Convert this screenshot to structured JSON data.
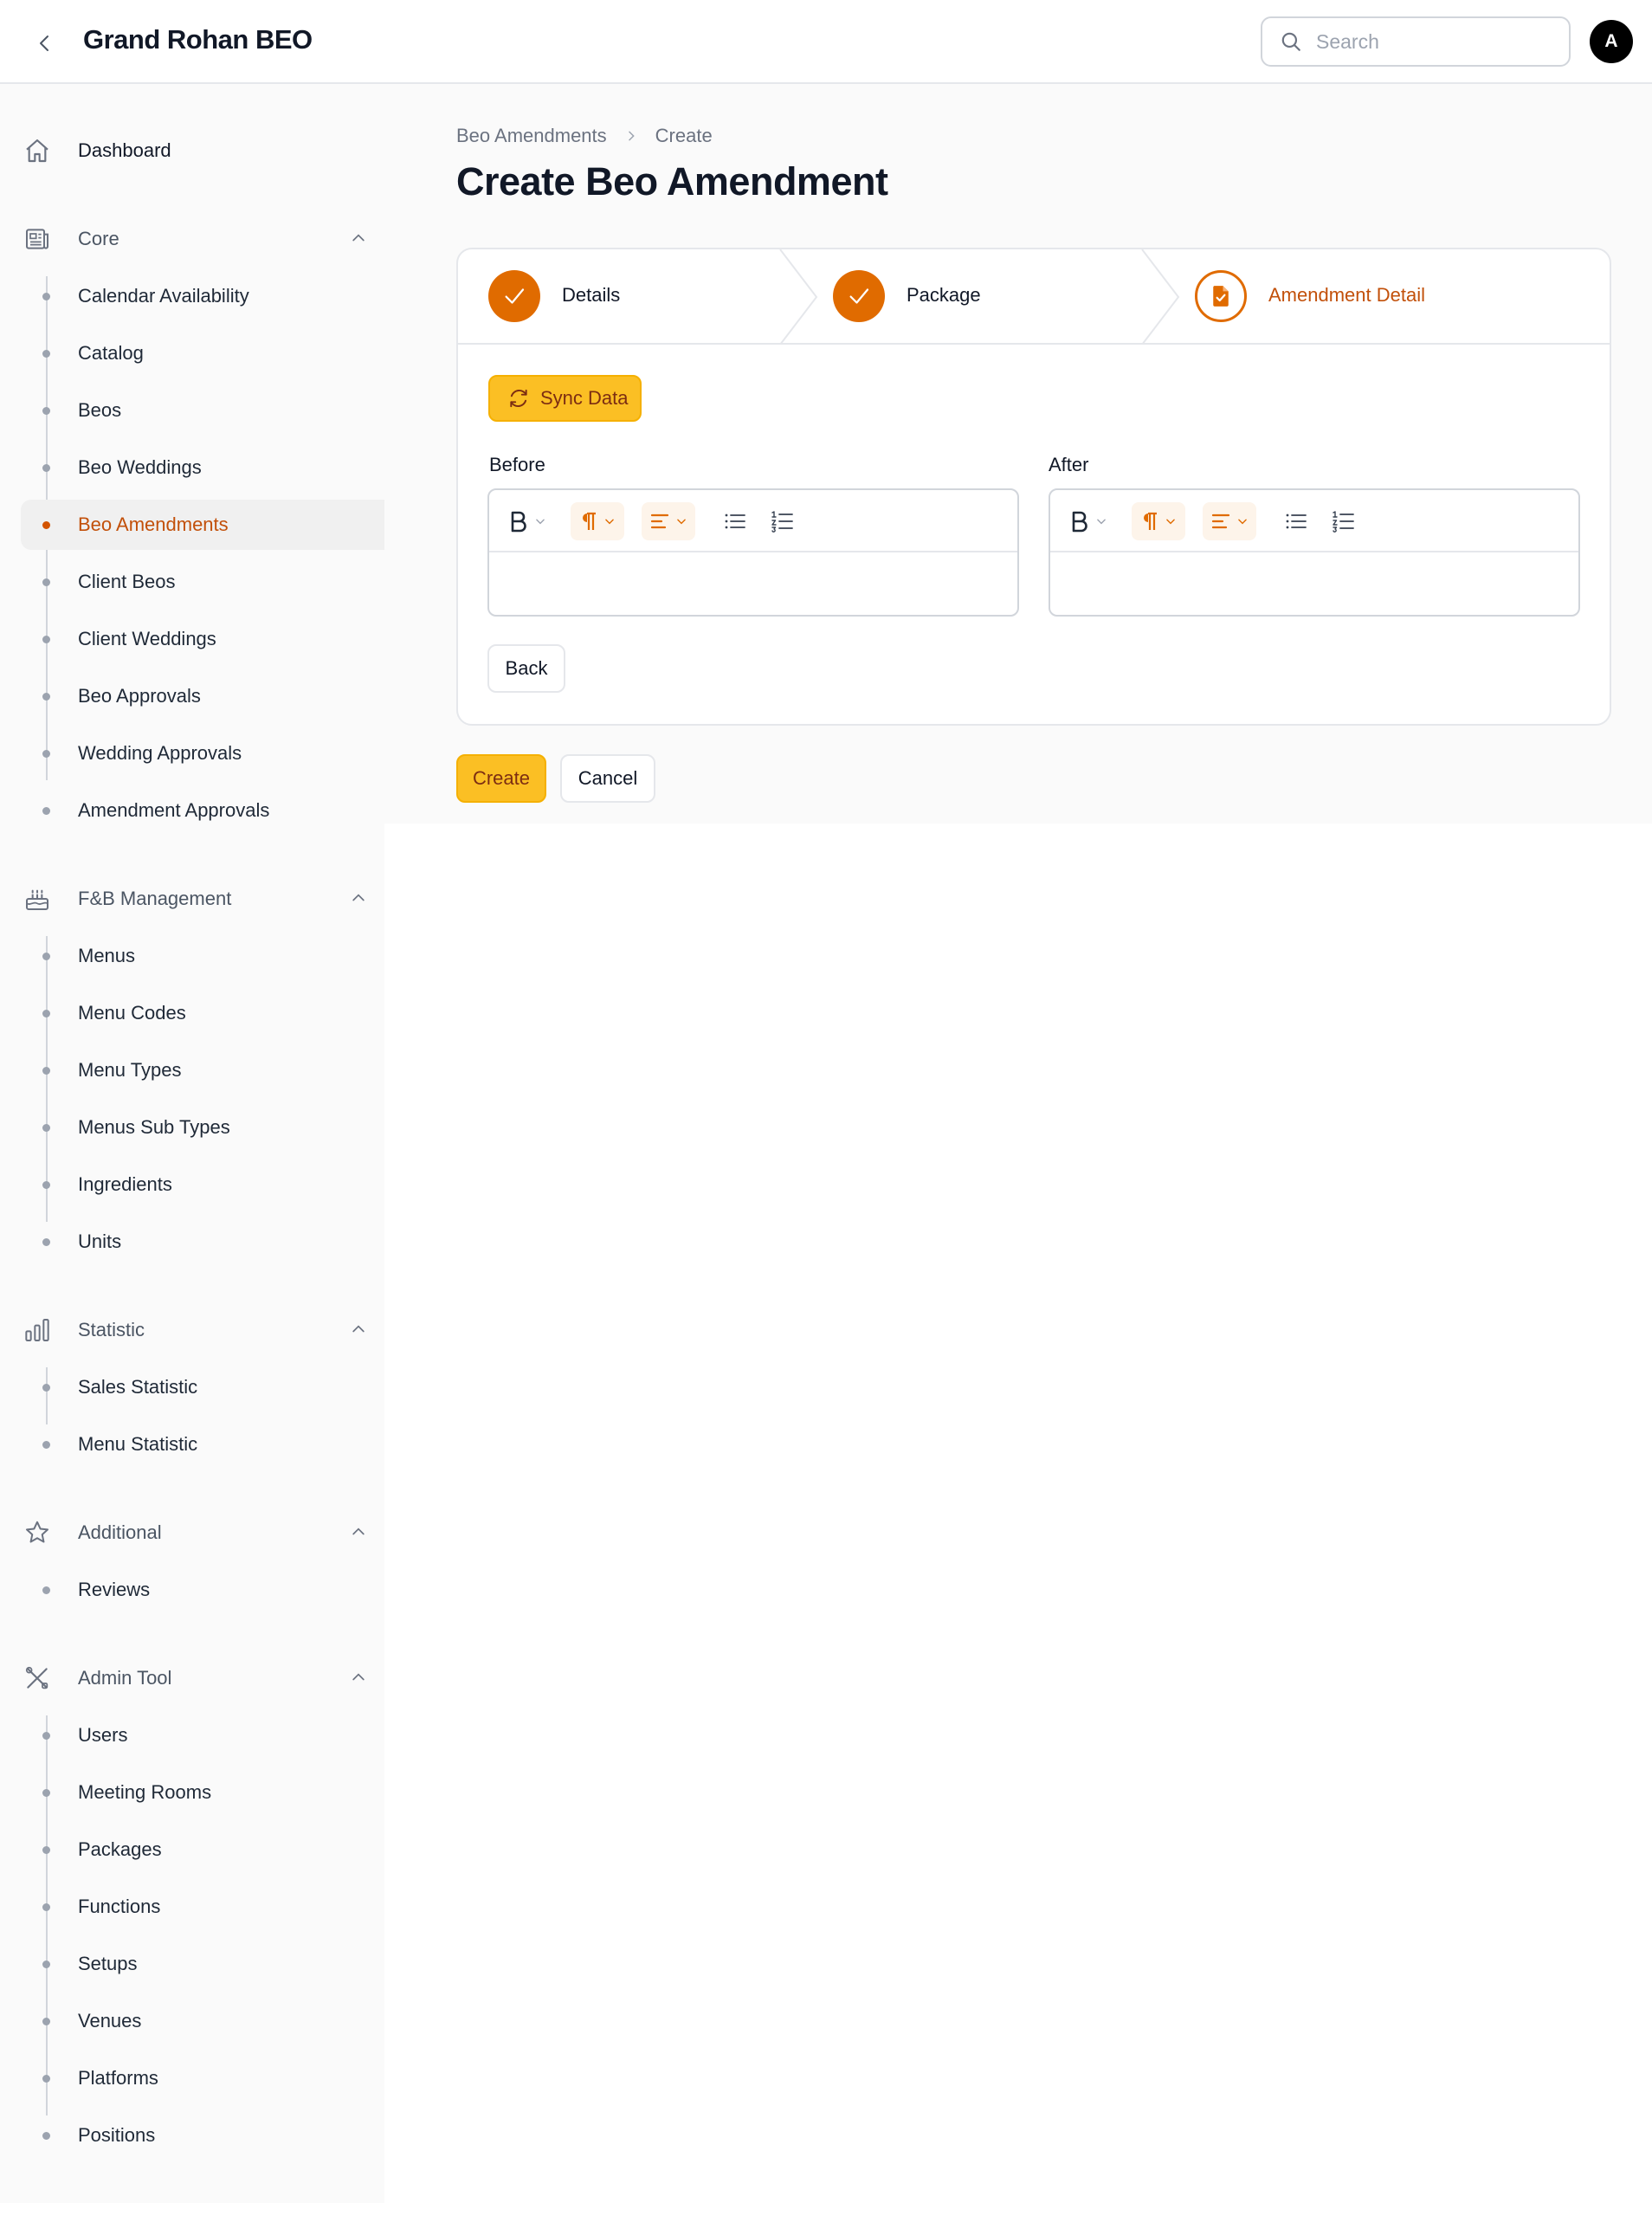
{
  "header": {
    "title": "Grand Rohan BEO",
    "search_placeholder": "Search",
    "avatar_initial": "A"
  },
  "sidebar": {
    "dashboard": {
      "label": "Dashboard",
      "icon": "home-icon"
    },
    "groups": [
      {
        "label": "Core",
        "icon": "newspaper-icon",
        "items": [
          "Calendar Availability",
          "Catalog",
          "Beos",
          "Beo Weddings",
          "Beo Amendments",
          "Client Beos",
          "Client Weddings",
          "Beo Approvals",
          "Wedding Approvals",
          "Amendment Approvals"
        ],
        "active_item": "Beo Amendments"
      },
      {
        "label": "F&B Management",
        "icon": "cake-icon",
        "items": [
          "Menus",
          "Menu Codes",
          "Menu Types",
          "Menus Sub Types",
          "Ingredients",
          "Units"
        ]
      },
      {
        "label": "Statistic",
        "icon": "chart-bar-icon",
        "items": [
          "Sales Statistic",
          "Menu Statistic"
        ]
      },
      {
        "label": "Additional",
        "icon": "star-icon",
        "items": [
          "Reviews"
        ]
      },
      {
        "label": "Admin Tool",
        "icon": "tools-icon",
        "items": [
          "Users",
          "Meeting Rooms",
          "Packages",
          "Functions",
          "Setups",
          "Venues",
          "Platforms",
          "Positions"
        ]
      }
    ]
  },
  "breadcrumb": {
    "parent": "Beo Amendments",
    "current": "Create"
  },
  "page": {
    "title": "Create Beo Amendment"
  },
  "wizard": {
    "steps": [
      {
        "label": "Details",
        "state": "complete"
      },
      {
        "label": "Package",
        "state": "complete"
      },
      {
        "label": "Amendment Detail",
        "state": "current"
      }
    ],
    "sync_button": "Sync Data",
    "editors": {
      "before_label": "Before",
      "after_label": "After"
    },
    "back_button": "Back"
  },
  "actions": {
    "create": "Create",
    "cancel": "Cancel"
  },
  "colors": {
    "accent": "#e06b00",
    "button_primary": "#fbbf24",
    "active_text": "#c2500a"
  }
}
